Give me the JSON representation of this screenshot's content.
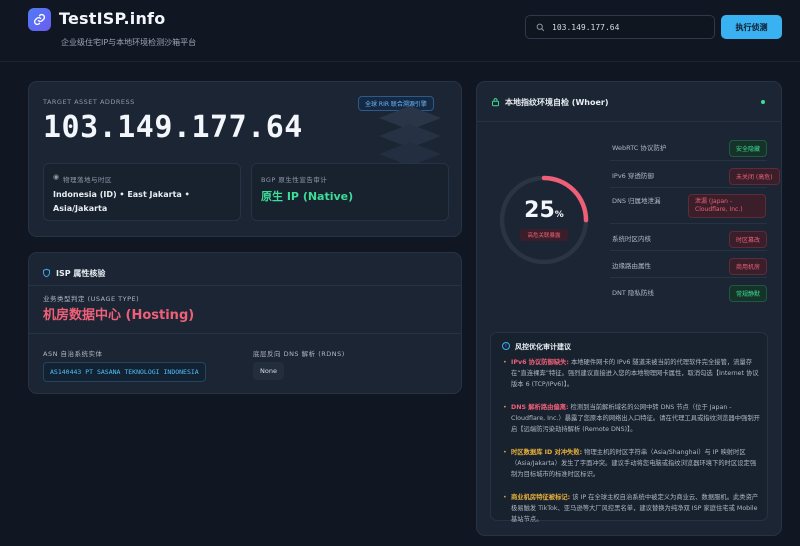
{
  "brand": {
    "title": "TestISP.info",
    "subtitle": "企业级住宅IP与本地环境检测沙箱平台"
  },
  "search": {
    "value": "103.149.177.64",
    "button": "执行侦测"
  },
  "target": {
    "label": "TARGET ASSET ADDRESS",
    "badge": "全球 RIR 联合溯源引擎",
    "ip": "103.149.177.64",
    "geo_label": "物理落地与时区",
    "geo_value": "Indonesia (ID) • East Jakarta • Asia/Jakarta",
    "bgp_label": "BGP 原生性宣告审计",
    "bgp_value": "原生 IP (Native)"
  },
  "isp": {
    "title": "ISP 属性核验",
    "type_label": "业务类型判定 (USAGE TYPE)",
    "type_value": "机房数据中心 (Hosting)",
    "asn_label": "ASN 自治系统实体",
    "asn_value": "AS140443 PT SASANA TEKNOLOGI INDONESIA",
    "rdns_label": "底层反向 DNS 解析 (RDNS)",
    "rdns_value": "None"
  },
  "whoer": {
    "title": "本地指纹环境自检 (Whoer)",
    "score": "25",
    "score_unit": "%",
    "score_badge": "高危关联暴露",
    "score_fraction": 0.25,
    "checks": [
      {
        "label": "WebRTC 协议防护",
        "status": "安全隐藏",
        "tone": "good"
      },
      {
        "label": "IPv6 穿透防御",
        "status": "未关闭 (高危)",
        "tone": "bad"
      },
      {
        "label": "DNS 归属地泄漏",
        "status": "泄漏 (Japan - Cloudflare, Inc.)",
        "tone": "bad"
      },
      {
        "label": "系统时区内核",
        "status": "时区篡改",
        "tone": "bad"
      },
      {
        "label": "边缘路由属性",
        "status": "商用机房",
        "tone": "bad"
      },
      {
        "label": "DNT 隐私防线",
        "status": "常规静默",
        "tone": "good"
      }
    ]
  },
  "advice": {
    "title": "风控优化审计建议",
    "items": [
      {
        "title": "IPv6 协议防御缺失:",
        "title_color": "#ef5f78",
        "text": "本地硬件网卡的 IPv6 隧道未被当前的代理软件完全接管，流量存在“直连裸奔”特征。强烈建议直接进入您的本地物理网卡属性，取消勾选【Internet 协议版本 6 (TCP/IPv6)】。"
      },
      {
        "title": "DNS 解析路由偏离:",
        "title_color": "#ef5f78",
        "text": "检测到当前解析域名的公网中转 DNS 节点（位于 Japan - Cloudflare, Inc.）暴露了您原本的网络出入口特征。请在代理工具或指纹浏览器中强制开启【远端防污染劫持解析 (Remote DNS)】。"
      },
      {
        "title": "时区数据库 ID 对冲失败:",
        "title_color": "#e8b23c",
        "text": "物理主机的时区字符串（Asia/Shanghai）与 IP 映射时区（Asia/Jakarta）发生了字面冲突。建议手动将您电脑或指纹浏览器环境下的时区设定强制为目标城市的标准时区标识。"
      },
      {
        "title": "商业机房特征被标记:",
        "title_color": "#e8b23c",
        "text": "该 IP 在全球主权自治系统中被定义为商业云、数据服机。此类资产极易触发 TikTok、亚马逊等大厂风控黑名单，建议替换为纯净双 ISP 家庭住宅或 Mobile 基站节点。"
      }
    ]
  },
  "colors": {
    "accent": "#3ab1f0",
    "danger": "#ef5f78",
    "good": "#3ddc97",
    "warn": "#e8b23c"
  }
}
